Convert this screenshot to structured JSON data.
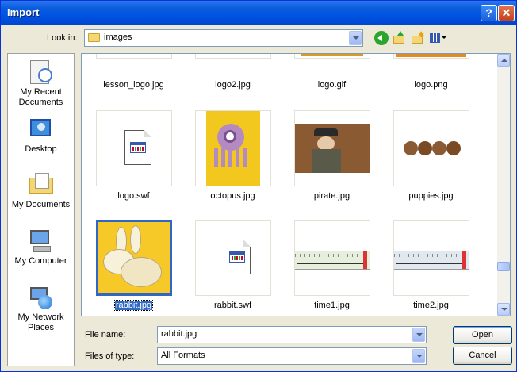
{
  "window": {
    "title": "Import",
    "help_label": "?",
    "close_label": "✕"
  },
  "lookin": {
    "label": "Look in:",
    "value": "images"
  },
  "toolbar": [
    "back-icon",
    "up-folder-icon",
    "new-folder-icon",
    "views-menu-icon"
  ],
  "places": [
    {
      "label": "My Recent Documents",
      "icon": "recent-documents-icon"
    },
    {
      "label": "Desktop",
      "icon": "desktop-icon"
    },
    {
      "label": "My Documents",
      "icon": "my-documents-icon"
    },
    {
      "label": "My Computer",
      "icon": "my-computer-icon"
    },
    {
      "label": "My Network Places",
      "icon": "network-places-icon"
    }
  ],
  "files": [
    {
      "name": "lesson_logo.jpg"
    },
    {
      "name": "logo2.jpg"
    },
    {
      "name": "logo.gif"
    },
    {
      "name": "logo.png"
    },
    {
      "name": "logo.swf"
    },
    {
      "name": "octopus.jpg"
    },
    {
      "name": "pirate.jpg"
    },
    {
      "name": "puppies.jpg"
    },
    {
      "name": "rabbit.jpg",
      "selected": true
    },
    {
      "name": "rabbit.swf"
    },
    {
      "name": "time1.jpg"
    },
    {
      "name": "time2.jpg"
    }
  ],
  "form": {
    "filename_label": "File name:",
    "filename_value": "rabbit.jpg",
    "filetype_label": "Files of type:",
    "filetype_value": "All Formats"
  },
  "buttons": {
    "open": "Open",
    "cancel": "Cancel"
  }
}
